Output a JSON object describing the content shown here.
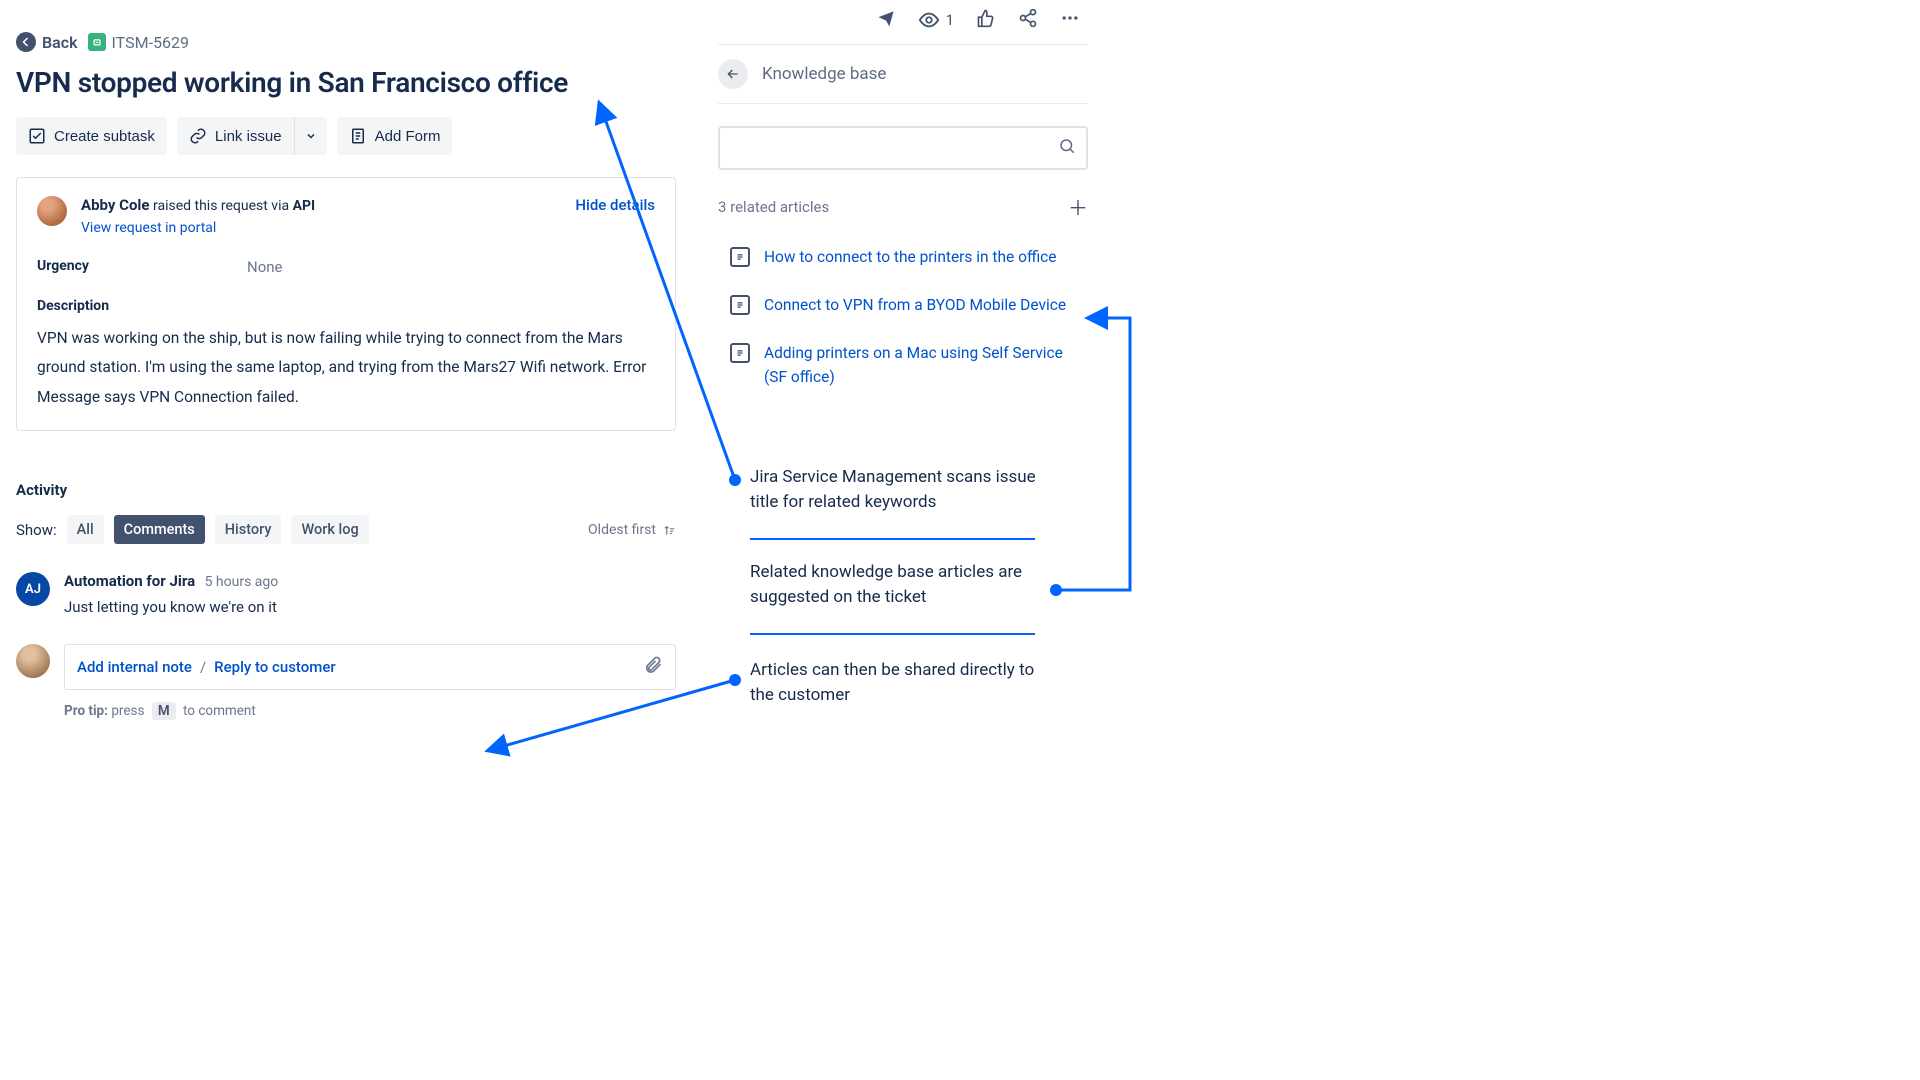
{
  "breadcrumb": {
    "back_label": "Back",
    "issue_key": "ITSM-5629"
  },
  "issue": {
    "title": "VPN stopped working in San Francisco office"
  },
  "actions": {
    "create_subtask": "Create subtask",
    "link_issue": "Link issue",
    "add_form": "Add Form"
  },
  "details": {
    "requester_name": "Abby Cole",
    "raised_via_text": " raised this request via ",
    "api_label": "API",
    "hide_details": "Hide details",
    "portal_link": "View request in portal",
    "urgency_label": "Urgency",
    "urgency_value": "None",
    "description_label": "Description",
    "description_body": "VPN was working on the ship, but is now failing while trying to connect from the Mars ground station. I'm using the same laptop, and trying from the Mars27 Wifi network. Error Message says VPN Connection failed."
  },
  "activity": {
    "header": "Activity",
    "show_label": "Show:",
    "tabs": {
      "all": "All",
      "comments": "Comments",
      "history": "History",
      "worklog": "Work log"
    },
    "sort_label": "Oldest first",
    "comment": {
      "avatar": "AJ",
      "author": "Automation for Jira",
      "time": "5 hours ago",
      "body": "Just letting you know we're on it"
    },
    "reply": {
      "add_note": "Add internal note",
      "reply_customer": "Reply to customer"
    },
    "protip_label": "Pro tip:",
    "protip_press": "press",
    "protip_key": "M",
    "protip_rest": "to comment"
  },
  "right": {
    "watch_count": "1",
    "kb_title": "Knowledge base",
    "search_placeholder": "",
    "related_label": "3 related articles",
    "articles": [
      "How to connect to the printers in the office",
      "Connect to VPN from a BYOD Mobile Device",
      "Adding printers on a Mac using Self Service (SF office)"
    ]
  },
  "callouts": {
    "c1": "Jira Service Management scans issue title for related keywords",
    "c2": "Related knowledge base articles are suggested on the ticket",
    "c3": "Articles can then be shared directly to the customer"
  }
}
